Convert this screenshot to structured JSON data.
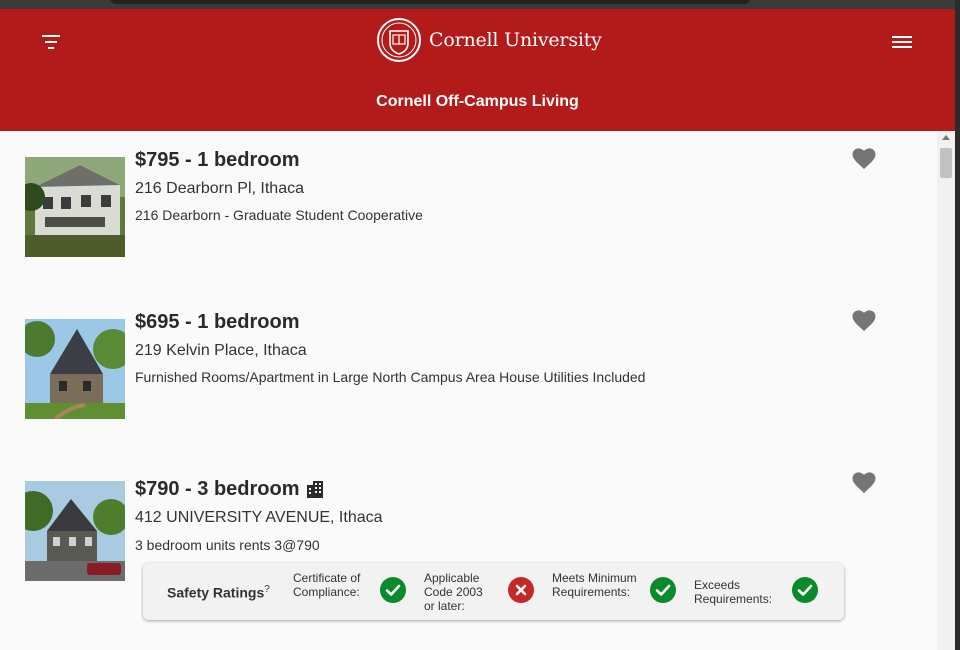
{
  "header": {
    "brand": "Cornell University",
    "app_title": "Cornell Off-Campus Living",
    "filter_icon": "filter-icon",
    "menu_icon": "hamburger-menu-icon",
    "color": "#b31b1b"
  },
  "listings": [
    {
      "price": "$795 - 1 bedroom",
      "address": "216 Dearborn Pl, Ithaca",
      "description": "216 Dearborn - Graduate Student Cooperative",
      "favorite_icon": "heart-icon"
    },
    {
      "price": "$695 - 1 bedroom",
      "address": "219 Kelvin Place, Ithaca",
      "description": "Furnished Rooms/Apartment in Large North Campus Area House Utilities Included",
      "favorite_icon": "heart-icon"
    },
    {
      "price": "$790 - 3 bedroom",
      "address": "412 UNIVERSITY AVENUE, Ithaca",
      "description": "3 bedroom units rents 3@790",
      "favorite_icon": "heart-icon",
      "type_icon": "building-icon",
      "safety": {
        "title": "Safety Ratings",
        "help_mark": "?",
        "items": [
          {
            "label": "Certificate of Compliance:",
            "status": "pass",
            "icon": "check-circle-icon"
          },
          {
            "label": "Applicable Code 2003 or later:",
            "status": "fail",
            "icon": "x-circle-icon"
          },
          {
            "label": "Meets Minimum Requirements:",
            "status": "pass",
            "icon": "check-circle-icon"
          },
          {
            "label": "Exceeds Requirements:",
            "status": "pass",
            "icon": "check-circle-icon"
          }
        ],
        "colors": {
          "pass": "#0a8a2a",
          "fail": "#c62828"
        }
      }
    }
  ]
}
